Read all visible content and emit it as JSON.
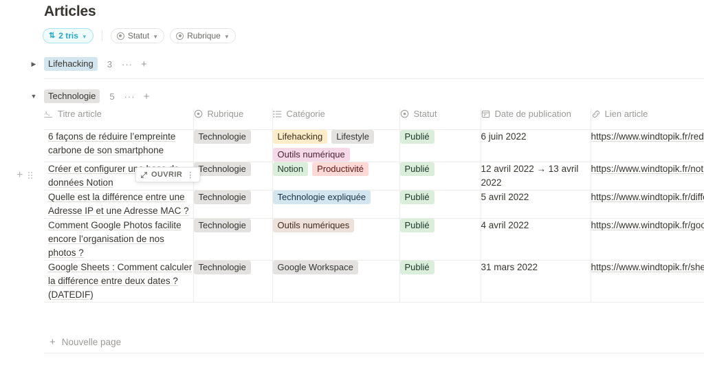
{
  "header": {
    "title": "Articles"
  },
  "toolbar": {
    "sort_chip": {
      "icon": "sort-icon",
      "label": "2 tris",
      "caret": "chevron-down-icon"
    },
    "filters": [
      {
        "icon": "select-icon",
        "label": "Statut",
        "caret": "chevron-down-icon"
      },
      {
        "icon": "select-icon",
        "label": "Rubrique",
        "caret": "chevron-down-icon"
      }
    ]
  },
  "groups": [
    {
      "name": "Lifehacking",
      "count": "3",
      "collapsed": true,
      "toggle_glyph": "▶",
      "color": "blue",
      "more_glyph": "···",
      "add_glyph": "+"
    },
    {
      "name": "Technologie",
      "count": "5",
      "collapsed": false,
      "toggle_glyph": "▼",
      "color": "gray",
      "more_glyph": "···",
      "add_glyph": "+"
    }
  ],
  "table": {
    "columns": [
      {
        "label": "Titre article",
        "icon": "title-text-icon"
      },
      {
        "label": "Rubrique",
        "icon": "select-icon"
      },
      {
        "label": "Catégorie",
        "icon": "multi-select-icon"
      },
      {
        "label": "Statut",
        "icon": "select-icon"
      },
      {
        "label": "Date de publication",
        "icon": "calendar-icon"
      },
      {
        "label": "Lien article",
        "icon": "link-icon"
      }
    ],
    "rows": [
      {
        "title": "6 façons de réduire l’empreinte carbone de son smartphone",
        "rubrique": [
          {
            "label": "Technologie",
            "color": "default"
          }
        ],
        "categorie": [
          {
            "label": "Lifehacking",
            "color": "yellow"
          },
          {
            "label": "Lifestyle",
            "color": "gray"
          },
          {
            "label": "Outils numérique",
            "color": "pink"
          }
        ],
        "statut": [
          {
            "label": "Publié",
            "color": "green"
          }
        ],
        "date": "6 juin 2022",
        "lien": "https://www.windtopik.fr/reduire-empreinte-carbone-de-son-smartphone/"
      },
      {
        "title": "Créer et configurer une base de données Notion",
        "rubrique": [
          {
            "label": "Technologie",
            "color": "default"
          }
        ],
        "categorie": [
          {
            "label": "Notion",
            "color": "green"
          },
          {
            "label": "Productivité",
            "color": "red"
          }
        ],
        "statut": [
          {
            "label": "Publié",
            "color": "green"
          }
        ],
        "date": "12 avril 2022 → 13 avril 2022",
        "lien": "https://www.windtopik.fr/notion-creer-configurer-base-de-donnees/",
        "hovered": true,
        "open_button": {
          "label": "OUVRIR",
          "icon": "expand-icon",
          "menu_glyph": "⋮"
        }
      },
      {
        "title": "Quelle est la différence entre une Adresse IP et une Adresse MAC ?",
        "rubrique": [
          {
            "label": "Technologie",
            "color": "default"
          }
        ],
        "categorie": [
          {
            "label": "Technologie expliquée",
            "color": "blue"
          }
        ],
        "statut": [
          {
            "label": "Publié",
            "color": "green"
          }
        ],
        "date": "5 avril 2022",
        "lien": "https://www.windtopik.fr/difference-adresse-ip-et-adresse-mac/"
      },
      {
        "title": "Comment Google Photos facilite encore l’organisation de nos photos ?",
        "rubrique": [
          {
            "label": "Technologie",
            "color": "default"
          }
        ],
        "categorie": [
          {
            "label": "Outils numériques",
            "color": "brown"
          }
        ],
        "statut": [
          {
            "label": "Publié",
            "color": "green"
          }
        ],
        "date": "4 avril 2022",
        "lien": "https://www.windtopik.fr/google-photos-amelioration-organisation-photos/"
      },
      {
        "title": "Google Sheets : Comment calculer la différence entre deux dates ? (DATEDIF)",
        "rubrique": [
          {
            "label": "Technologie",
            "color": "default"
          }
        ],
        "categorie": [
          {
            "label": "Google Workspace",
            "color": "default"
          }
        ],
        "statut": [
          {
            "label": "Publié",
            "color": "green"
          }
        ],
        "date": "31 mars 2022",
        "lien": "https://www.windtopik.fr/sheets-calculer-difference-entre-deux-dates-datedif/"
      }
    ],
    "new_row": {
      "label": "Nouvelle page",
      "icon": "plus-icon"
    }
  },
  "row_controls": {
    "add_glyph": "+",
    "drag_handle": "drag-handle-icon"
  },
  "colors": {
    "accent_sort": "#2aa7c4",
    "tag_yellow": "#fdecc8",
    "tag_gray": "#e3e2e0",
    "tag_pink": "#f5d9e8",
    "tag_green": "#dbeddb",
    "tag_red": "#ffd9d5",
    "tag_blue": "#d3e5ef",
    "tag_brown": "#eee0da",
    "border": "#ececeb"
  }
}
